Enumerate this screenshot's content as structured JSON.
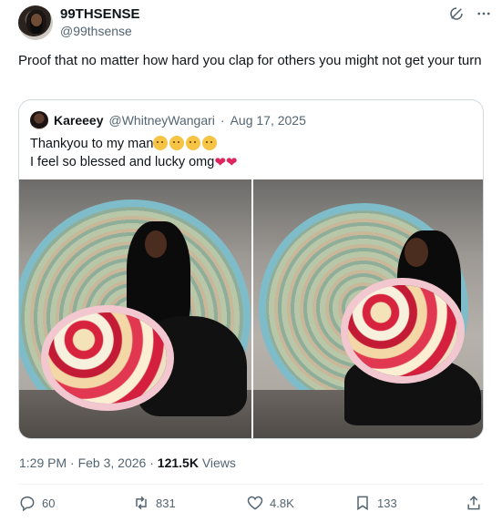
{
  "author": {
    "display_name": "99THSENSE",
    "handle": "@99thsense"
  },
  "tweet": {
    "text": "Proof that no matter how hard you clap for others you might not get your turn"
  },
  "quote": {
    "display_name": "Kareeey",
    "handle": "@WhitneyWangari",
    "separator": "·",
    "date": "Aug 17, 2025",
    "line1": "Thankyou to my man",
    "line2": "I feel so blessed and lucky omg",
    "line1_emojis": [
      "smiling-face-with-tear-emoji",
      "smiling-face-with-tear-emoji",
      "smiling-face-with-tear-emoji",
      "smiling-face-with-tear-emoji"
    ],
    "line2_emojis": [
      "red-heart-emoji",
      "red-heart-emoji"
    ]
  },
  "meta": {
    "time": "1:29 PM",
    "separator": "·",
    "date": "Feb 3, 2026",
    "views_count": "121.5K",
    "views_label": "Views"
  },
  "actions": {
    "replies": "60",
    "reposts": "831",
    "likes": "4.8K",
    "bookmarks": "133"
  },
  "colors": {
    "text": "#0f1419",
    "secondary": "#536471",
    "border": "#cfd9de",
    "heart": "#e0245e"
  },
  "icons": [
    "grok-icon",
    "more-icon",
    "reply-icon",
    "repost-icon",
    "like-icon",
    "bookmark-icon",
    "share-icon"
  ]
}
